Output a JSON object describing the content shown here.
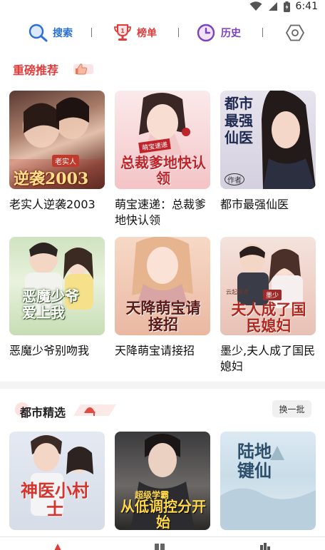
{
  "status_bar": {
    "time": "6:41"
  },
  "top_nav": {
    "items": [
      {
        "label": "搜索",
        "icon": "search-icon",
        "color": "#2a6fd6"
      },
      {
        "label": "榜单",
        "icon": "trophy-icon",
        "color": "#e23b3b"
      },
      {
        "label": "历史",
        "icon": "clock-icon",
        "color": "#7b3fbf"
      }
    ],
    "settings_icon": "settings-hexagon-icon"
  },
  "sections": [
    {
      "title": "重磅推荐",
      "books": [
        {
          "title": "老实人逆袭2003",
          "cover_text": "逆袭2003",
          "cover_sub": "老实人"
        },
        {
          "title": "萌宝速递：总裁爹地快认领",
          "cover_text": "总裁爹地快认领",
          "cover_sub": "萌宝速递"
        },
        {
          "title": "都市最强仙医",
          "cover_text": "都市最强仙医",
          "cover_sub": "作者"
        },
        {
          "title": "恶魔少爷别吻我",
          "cover_text": "恶魔少爷爱上我",
          "cover_sub": ""
        },
        {
          "title": "天降萌宝请接招",
          "cover_text": "天降萌宝请接招",
          "cover_sub": ""
        },
        {
          "title": "墨少,夫人成了国民媳妇",
          "cover_text": "夫人成了国民媳妇",
          "cover_sub": "墨少"
        }
      ]
    },
    {
      "title": "都市精选",
      "refresh_label": "换一批",
      "books": [
        {
          "title": "",
          "cover_text": "神医小村士",
          "cover_sub": ""
        },
        {
          "title": "",
          "cover_text": "从低调控分开始",
          "cover_sub": "超级学霸"
        },
        {
          "title": "",
          "cover_text": "陆地键仙",
          "cover_sub": ""
        }
      ]
    }
  ],
  "colors": {
    "accent_red": "#e03b3b",
    "search_blue": "#2a6fd6",
    "history_purple": "#7b3fbf"
  }
}
